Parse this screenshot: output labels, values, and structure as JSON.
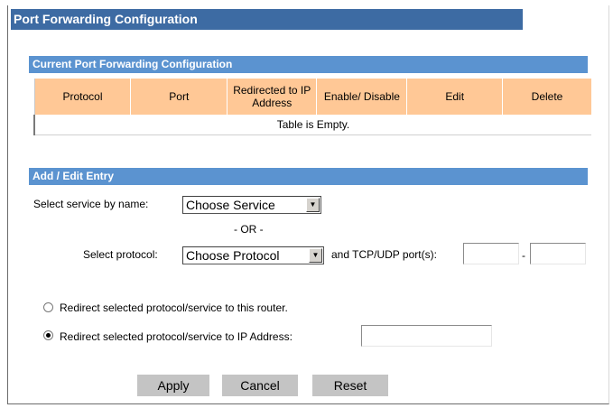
{
  "page": {
    "title": "Port Forwarding Configuration"
  },
  "current_section": {
    "title": "Current Port Forwarding Configuration",
    "columns": [
      "Protocol",
      "Port",
      "Redirected to IP Address",
      "Enable/ Disable",
      "Edit",
      "Delete"
    ],
    "empty_message": "Table is Empty."
  },
  "entry_section": {
    "title": "Add / Edit Entry",
    "service_label": "Select service by name:",
    "service_value": "Choose Service",
    "or_text": "- OR -",
    "protocol_label": "Select protocol:",
    "protocol_value": "Choose Protocol",
    "port_label": "and TCP/UDP port(s):",
    "port_from": "",
    "port_separator": "-",
    "port_to": "",
    "radio_router_label": "Redirect selected protocol/service to this router.",
    "radio_ip_label": "Redirect selected protocol/service to IP Address:",
    "ip_value": "",
    "selected_radio": "ip"
  },
  "buttons": {
    "apply": "Apply",
    "cancel": "Cancel",
    "reset": "Reset"
  },
  "colors": {
    "title_bar": "#3d6ba3",
    "section_bar": "#5b93d0",
    "header_cell": "#ffc896",
    "button": "#c4c4c4"
  }
}
